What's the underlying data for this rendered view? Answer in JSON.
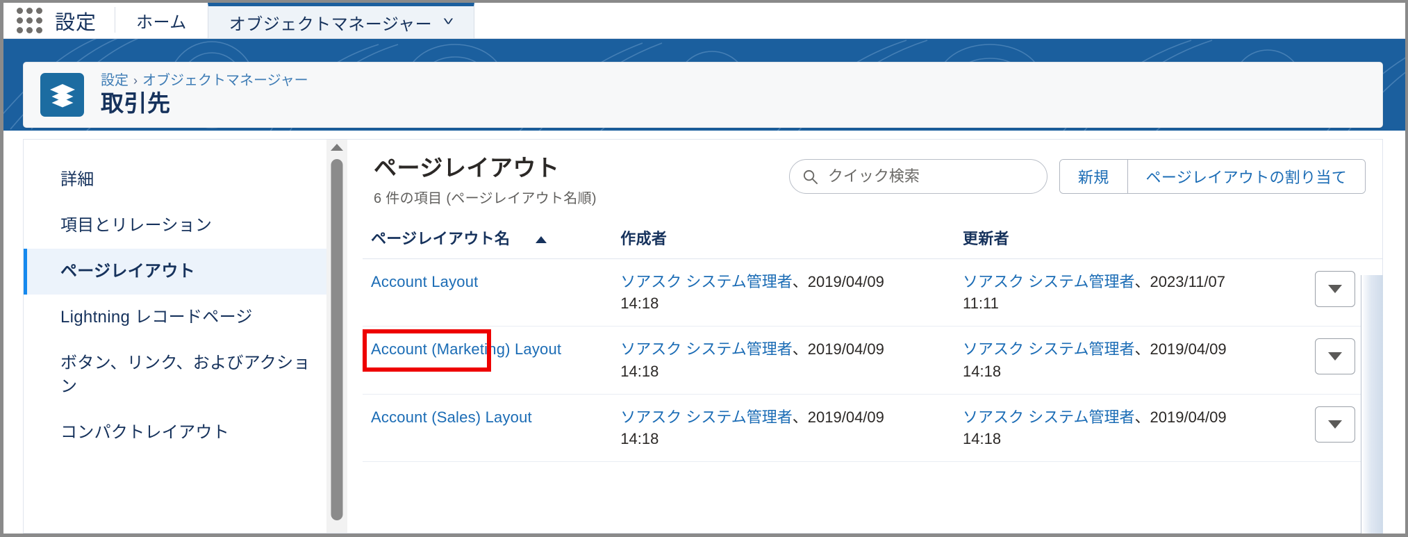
{
  "window": {
    "accent_blue": "#1b5f9e",
    "link_blue": "#1b6cb5",
    "highlight_red": "#ee0000"
  },
  "global_nav": {
    "app_launcher_icon": "app-launcher-waffle-icon",
    "setup_label": "設定",
    "tabs": [
      {
        "label": "ホーム",
        "active": false,
        "has_chevron": false
      },
      {
        "label": "オブジェクトマネージャー",
        "active": true,
        "has_chevron": true,
        "chevron": "˅"
      }
    ]
  },
  "record_header": {
    "icon_name": "object-layers-icon",
    "breadcrumb": {
      "root": "設定",
      "separator": "›",
      "current": "オブジェクトマネージャー"
    },
    "title": "取引先"
  },
  "sidebar": {
    "items": [
      {
        "label": "詳細",
        "active": false
      },
      {
        "label": "項目とリレーション",
        "active": false
      },
      {
        "label": "ページレイアウト",
        "active": true
      },
      {
        "label": "Lightning レコードページ",
        "active": false
      },
      {
        "label": "ボタン、リンク、およびアクション",
        "active": false
      },
      {
        "label": "コンパクトレイアウト",
        "active": false
      }
    ],
    "scrollbar": {
      "up_arrow_icon": "scroll-up-arrow-icon"
    }
  },
  "main": {
    "title": "ページレイアウト",
    "subtitle": "6 件の項目 (ページレイアウト名順)",
    "search": {
      "icon": "search-icon",
      "placeholder": "クイック検索",
      "value": ""
    },
    "buttons": [
      {
        "label": "新規"
      },
      {
        "label": "ページレイアウトの割り当て"
      }
    ],
    "table": {
      "columns": [
        {
          "label": "ページレイアウト名",
          "sorted": true,
          "sort_direction": "asc"
        },
        {
          "label": "作成者",
          "sorted": false
        },
        {
          "label": "更新者",
          "sorted": false
        },
        {
          "label": "",
          "sorted": false
        }
      ],
      "rows": [
        {
          "name": "Account Layout",
          "highlighted": true,
          "created_by": "ソアスク システム管理者",
          "created_sep": "、",
          "created_date": "2019/04/09",
          "created_time": "14:18",
          "updated_by": "ソアスク システム管理者",
          "updated_sep": "、",
          "updated_date": "2023/11/07",
          "updated_time": "11:11",
          "menu_icon": "row-actions-caret-icon"
        },
        {
          "name": "Account (Marketing) Layout",
          "highlighted": false,
          "created_by": "ソアスク システム管理者",
          "created_sep": "、",
          "created_date": "2019/04/09",
          "created_time": "14:18",
          "updated_by": "ソアスク システム管理者",
          "updated_sep": "、",
          "updated_date": "2019/04/09",
          "updated_time": "14:18",
          "menu_icon": "row-actions-caret-icon"
        },
        {
          "name": "Account (Sales) Layout",
          "highlighted": false,
          "created_by": "ソアスク システム管理者",
          "created_sep": "、",
          "created_date": "2019/04/09",
          "created_time": "14:18",
          "updated_by": "ソアスク システム管理者",
          "updated_sep": "、",
          "updated_date": "2019/04/09",
          "updated_time": "14:18",
          "menu_icon": "row-actions-caret-icon"
        }
      ]
    }
  }
}
